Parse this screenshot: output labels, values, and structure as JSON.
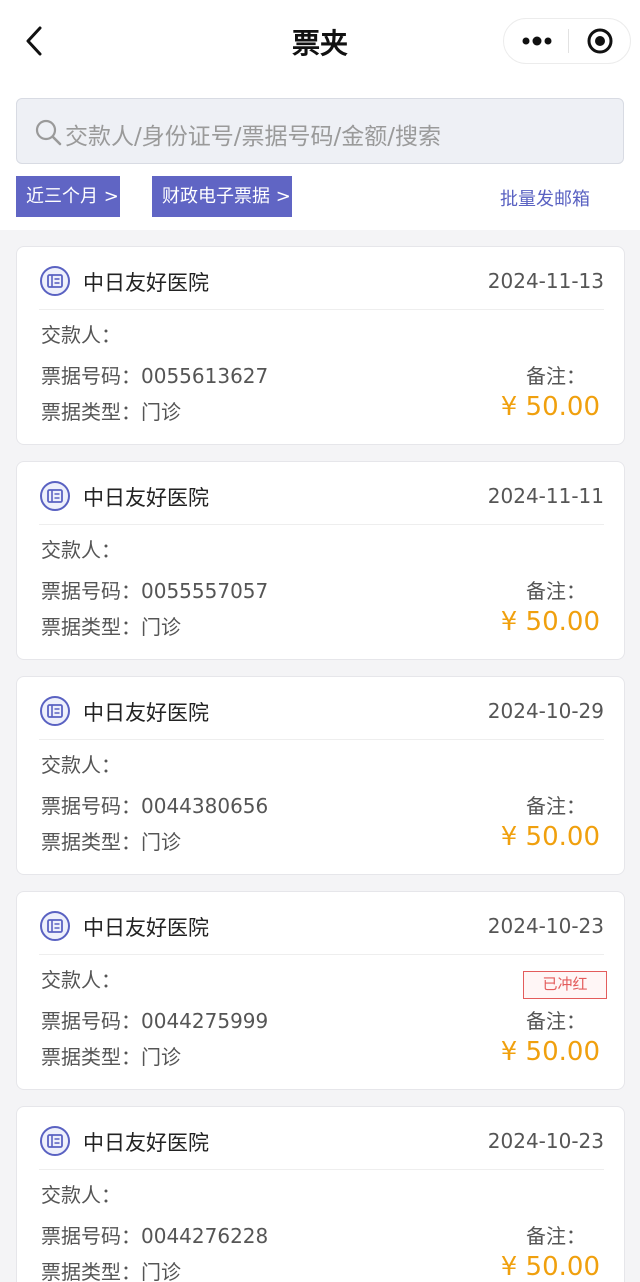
{
  "header": {
    "title": "票夹"
  },
  "search": {
    "placeholder": "交款人/身份证号/票据号码/金额/搜索"
  },
  "filters": {
    "period": "近三个月 >",
    "category": "财政电子票据 >",
    "batch": "批量发邮箱"
  },
  "labels": {
    "payer": "交款人：",
    "bill_number": "票据号码：",
    "bill_type": "票据类型：",
    "remark": "备注："
  },
  "colors": {
    "accent": "#6065c4",
    "amount": "#f0a00e",
    "stamp": "#e35c5c"
  },
  "receipts": [
    {
      "hospital": "中日友好医院",
      "date": "2024-11-13",
      "number": "0055613627",
      "type": "门诊",
      "amount": "¥ 50.00",
      "stamp": ""
    },
    {
      "hospital": "中日友好医院",
      "date": "2024-11-11",
      "number": "0055557057",
      "type": "门诊",
      "amount": "¥ 50.00",
      "stamp": ""
    },
    {
      "hospital": "中日友好医院",
      "date": "2024-10-29",
      "number": "0044380656",
      "type": "门诊",
      "amount": "¥ 50.00",
      "stamp": ""
    },
    {
      "hospital": "中日友好医院",
      "date": "2024-10-23",
      "number": "0044275999",
      "type": "门诊",
      "amount": "¥ 50.00",
      "stamp": "已冲红"
    },
    {
      "hospital": "中日友好医院",
      "date": "2024-10-23",
      "number": "0044276228",
      "type": "门诊",
      "amount": "¥ 50.00",
      "stamp": ""
    }
  ]
}
